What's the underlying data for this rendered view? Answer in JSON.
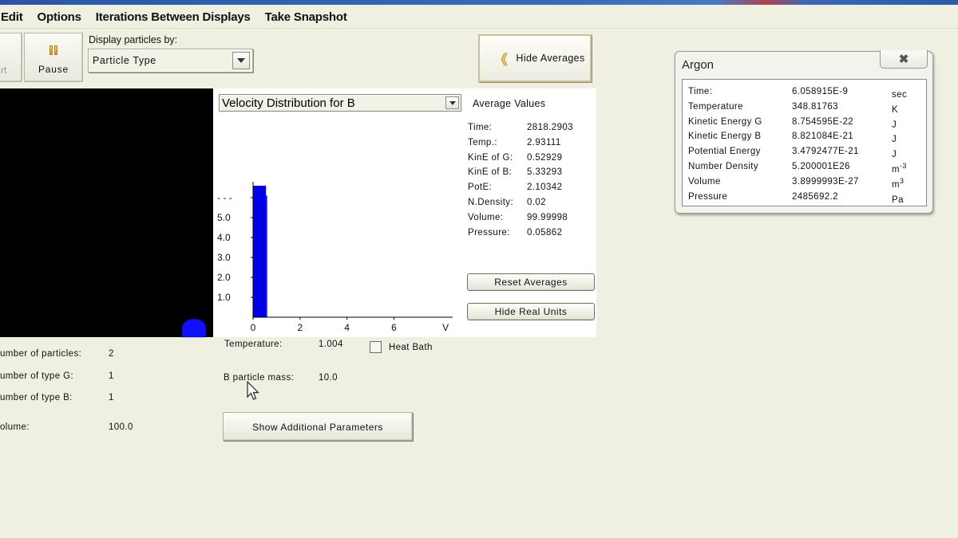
{
  "menu": {
    "items": [
      "Edit",
      "Options",
      "Iterations Between Displays",
      "Take Snapshot"
    ]
  },
  "toolbar": {
    "start_label": "rt",
    "pause_label": "Pause",
    "display_by_label": "Display particles by:",
    "display_by_value": "Particle Type",
    "hide_averages_label": "Hide Averages"
  },
  "chart_select": {
    "value": "Velocity Distribution for B"
  },
  "chart_data": {
    "type": "bar",
    "title": "Velocity Distribution for B",
    "xlabel": "V",
    "ylabel": "",
    "x_ticks": [
      "0",
      "2",
      "4",
      "6",
      "V"
    ],
    "y_ticks": [
      "1.0",
      "2.0",
      "3.0",
      "4.0",
      "5.0",
      "..."
    ],
    "xlim": [
      0,
      8.5
    ],
    "ylim": [
      0,
      7
    ],
    "bins": [
      {
        "x0": 0.0,
        "x1": 0.55,
        "value": 6.6
      },
      {
        "x0": 0.55,
        "x1": 0.6,
        "value": 6.1
      }
    ],
    "color": "#0000e6",
    "grid": false
  },
  "averages": {
    "title": "Average Values",
    "rows": [
      {
        "key": "Time:",
        "value": "2818.2903"
      },
      {
        "key": "Temp.:",
        "value": "2.93111"
      },
      {
        "key": "KinE of G:",
        "value": "0.52929"
      },
      {
        "key": "KinE of B:",
        "value": "5.33293"
      },
      {
        "key": "PotE:",
        "value": "2.10342"
      },
      {
        "key": "N.Density:",
        "value": "0.02"
      },
      {
        "key": "Volume:",
        "value": "99.99998"
      },
      {
        "key": "Pressure:",
        "value": "0.05862"
      }
    ],
    "reset_label": "Reset Averages",
    "hide_units_label": "Hide Real Units"
  },
  "system": {
    "num_particles_label": "umber of particles:",
    "num_particles": "2",
    "num_g_label": "umber of type G:",
    "num_g": "1",
    "num_b_label": "umber of type B:",
    "num_b": "1",
    "volume_label": "olume:",
    "volume": "100.0"
  },
  "params": {
    "temperature_label": "Temperature:",
    "temperature": "1.004",
    "heat_bath_label": "Heat Bath",
    "heat_bath_checked": false,
    "b_mass_label": "B particle mass:",
    "b_mass": "10.0",
    "show_additional_label": "Show Additional Parameters"
  },
  "dialog": {
    "title": "Argon",
    "close_icon": "close-x",
    "rows": [
      {
        "key": "Time:",
        "value": "6.058915E-9",
        "unit": "sec",
        "sup": ""
      },
      {
        "key": "Temperature",
        "value": "348.81763",
        "unit": "K",
        "sup": ""
      },
      {
        "key": "Kinetic Energy G",
        "value": "8.754595E-22",
        "unit": "J",
        "sup": ""
      },
      {
        "key": "Kinetic Energy B",
        "value": "8.821084E-21",
        "unit": "J",
        "sup": ""
      },
      {
        "key": "Potential Energy",
        "value": "3.4792477E-21",
        "unit": "J",
        "sup": ""
      },
      {
        "key": "Number Density",
        "value": "5.200001E26",
        "unit": "m",
        "sup": "-3"
      },
      {
        "key": "Volume",
        "value": "3.8999993E-27",
        "unit": "m",
        "sup": "3"
      },
      {
        "key": "Pressure",
        "value": "2485692.2",
        "unit": "Pa",
        "sup": ""
      }
    ]
  },
  "colors": {
    "background": "#efefe2",
    "particle_b": "#1010ff",
    "sim_background": "#000000"
  }
}
